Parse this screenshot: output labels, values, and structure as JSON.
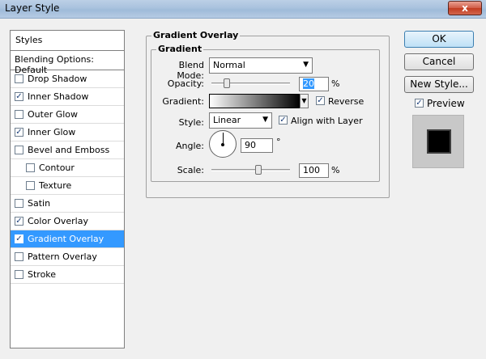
{
  "window": {
    "title": "Layer Style",
    "close_glyph": "x"
  },
  "styles_panel": {
    "header": "Styles",
    "blending_options": "Blending Options: Default",
    "items": [
      {
        "label": "Drop Shadow",
        "checked": false,
        "sub": false,
        "selected": false
      },
      {
        "label": "Inner Shadow",
        "checked": true,
        "sub": false,
        "selected": false
      },
      {
        "label": "Outer Glow",
        "checked": false,
        "sub": false,
        "selected": false
      },
      {
        "label": "Inner Glow",
        "checked": true,
        "sub": false,
        "selected": false
      },
      {
        "label": "Bevel and Emboss",
        "checked": false,
        "sub": false,
        "selected": false
      },
      {
        "label": "Contour",
        "checked": false,
        "sub": true,
        "selected": false
      },
      {
        "label": "Texture",
        "checked": false,
        "sub": true,
        "selected": false
      },
      {
        "label": "Satin",
        "checked": false,
        "sub": false,
        "selected": false
      },
      {
        "label": "Color Overlay",
        "checked": true,
        "sub": false,
        "selected": false
      },
      {
        "label": "Gradient Overlay",
        "checked": true,
        "sub": false,
        "selected": true
      },
      {
        "label": "Pattern Overlay",
        "checked": false,
        "sub": false,
        "selected": false
      },
      {
        "label": "Stroke",
        "checked": false,
        "sub": false,
        "selected": false
      }
    ]
  },
  "gradient_overlay": {
    "group_title": "Gradient Overlay",
    "subgroup_title": "Gradient",
    "blend_mode_label": "Blend Mode:",
    "blend_mode_value": "Normal",
    "opacity_label": "Opacity:",
    "opacity_value": "20",
    "opacity_unit": "%",
    "opacity_fraction": 0.2,
    "gradient_label": "Gradient:",
    "reverse_label": "Reverse",
    "reverse_checked": true,
    "style_label": "Style:",
    "style_value": "Linear",
    "align_label": "Align with Layer",
    "align_checked": true,
    "angle_label": "Angle:",
    "angle_value": "90",
    "angle_unit": "°",
    "scale_label": "Scale:",
    "scale_value": "100",
    "scale_unit": "%",
    "scale_fraction": 0.6
  },
  "buttons": {
    "ok": "OK",
    "cancel": "Cancel",
    "new_style": "New Style...",
    "preview_label": "Preview",
    "preview_checked": true
  },
  "colors": {
    "selection": "#3399ff",
    "default_button": "#bfe1f6"
  }
}
